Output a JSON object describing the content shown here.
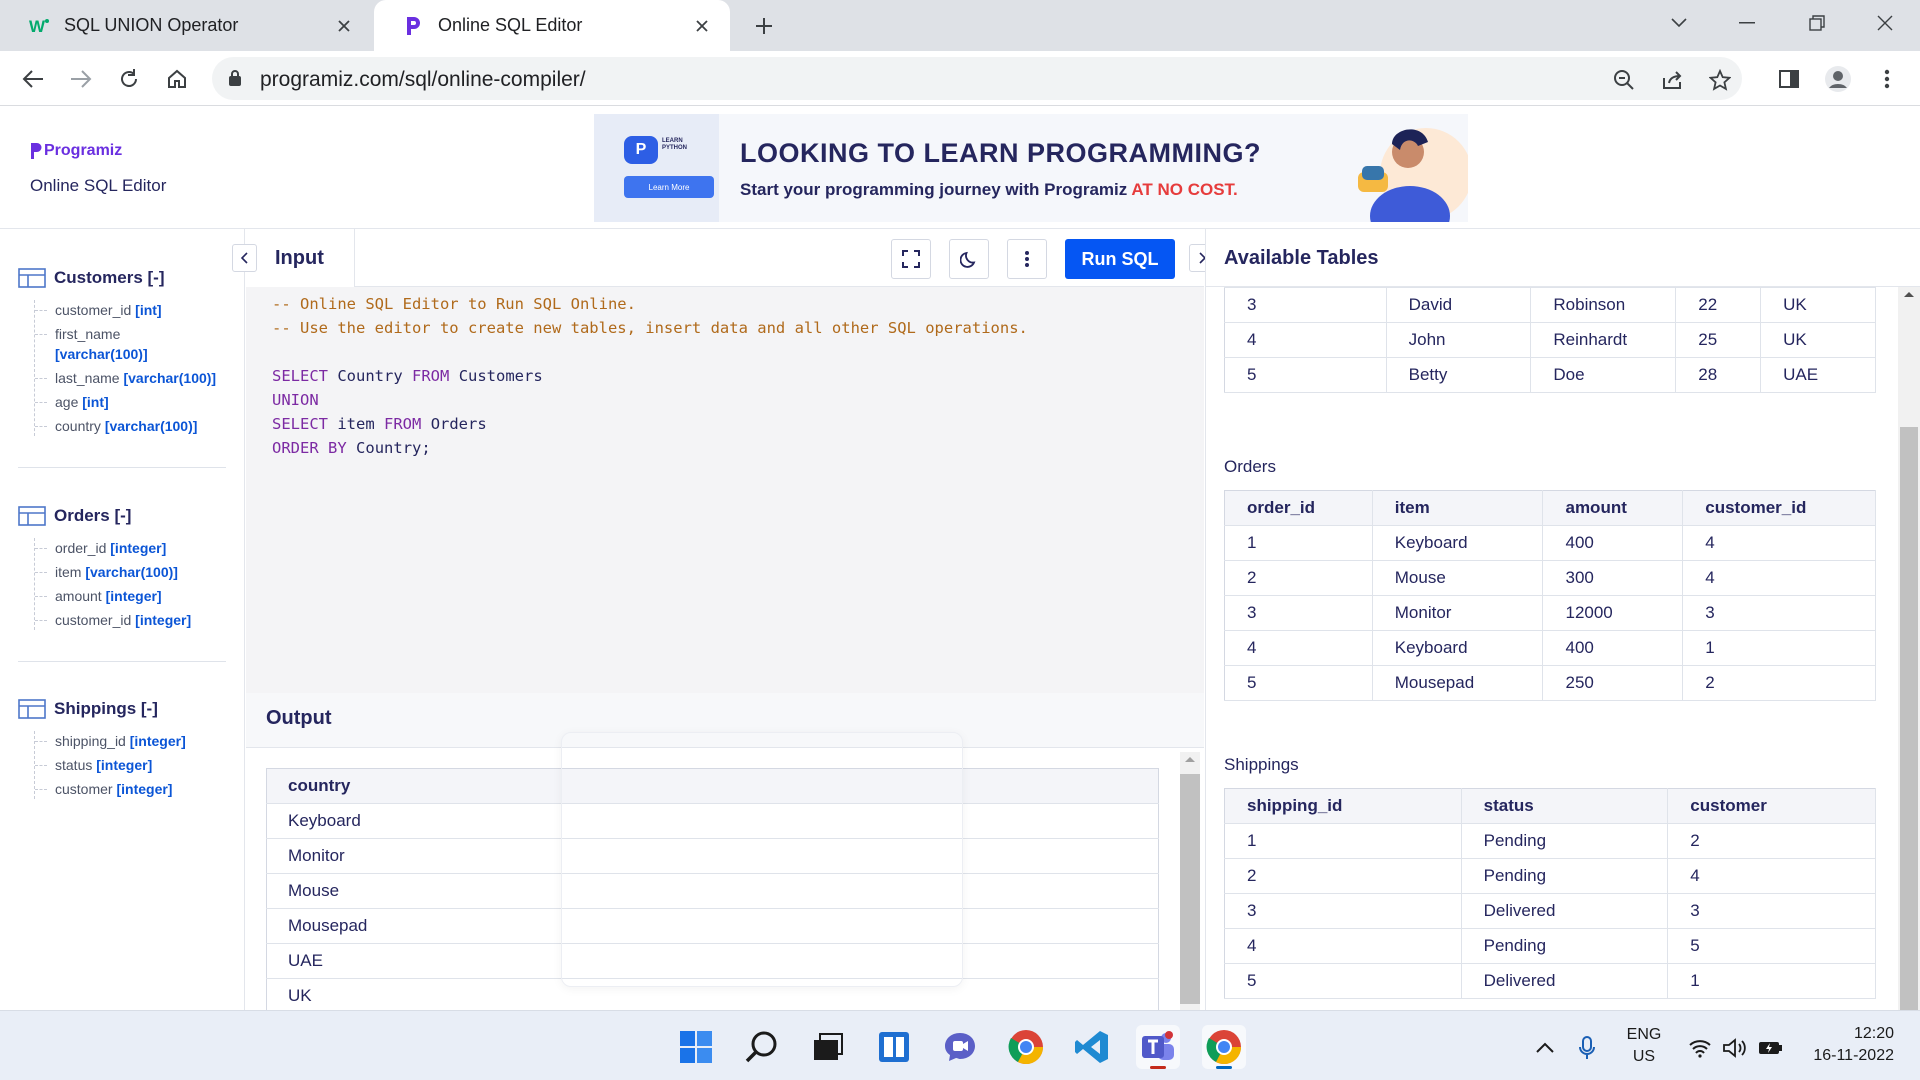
{
  "browser": {
    "tabs": [
      {
        "title": "SQL UNION Operator",
        "active": false
      },
      {
        "title": "Online SQL Editor",
        "active": true
      }
    ],
    "url": "programiz.com/sql/online-compiler/"
  },
  "header": {
    "brand": "Programiz",
    "subtitle": "Online SQL Editor",
    "ad": {
      "badge_text": "LEARN PYTHON",
      "button": "Learn More",
      "headline": "LOOKING TO LEARN PROGRAMMING?",
      "subline": "Start your programming journey with Programiz",
      "subline_accent": "AT NO COST."
    }
  },
  "schema": [
    {
      "name": "Customers [-]",
      "fields": [
        {
          "name": "customer_id",
          "type": "[int]"
        },
        {
          "name": "first_name",
          "type": "[varchar(100)]"
        },
        {
          "name": "last_name",
          "type": "[varchar(100)]"
        },
        {
          "name": "age",
          "type": "[int]"
        },
        {
          "name": "country",
          "type": "[varchar(100)]"
        }
      ]
    },
    {
      "name": "Orders [-]",
      "fields": [
        {
          "name": "order_id",
          "type": "[integer]"
        },
        {
          "name": "item",
          "type": "[varchar(100)]"
        },
        {
          "name": "amount",
          "type": "[integer]"
        },
        {
          "name": "customer_id",
          "type": "[integer]"
        }
      ]
    },
    {
      "name": "Shippings [-]",
      "fields": [
        {
          "name": "shipping_id",
          "type": "[integer]"
        },
        {
          "name": "status",
          "type": "[integer]"
        },
        {
          "name": "customer",
          "type": "[integer]"
        }
      ]
    }
  ],
  "editor": {
    "tab_label": "Input",
    "run_label": "Run SQL",
    "code": [
      {
        "text": "-- Online SQL Editor to Run SQL Online.",
        "kind": "comment"
      },
      {
        "text": "-- Use the editor to create new tables, insert data and all other SQL operations.",
        "kind": "comment"
      },
      {
        "text": "",
        "kind": "plain"
      },
      {
        "text": "SELECT Country FROM Customers",
        "kind": "sql"
      },
      {
        "text": "UNION",
        "kind": "sql"
      },
      {
        "text": "SELECT item FROM Orders",
        "kind": "sql"
      },
      {
        "text": "ORDER BY Country;",
        "kind": "sql"
      }
    ]
  },
  "output": {
    "title": "Output",
    "columns": [
      "country"
    ],
    "rows": [
      [
        "Keyboard"
      ],
      [
        "Monitor"
      ],
      [
        "Mouse"
      ],
      [
        "Mousepad"
      ],
      [
        "UAE"
      ],
      [
        "UK"
      ]
    ]
  },
  "available_tables": {
    "title": "Available Tables",
    "customers_partial": {
      "rows": [
        [
          "3",
          "David",
          "Robinson",
          "22",
          "UK"
        ],
        [
          "4",
          "John",
          "Reinhardt",
          "25",
          "UK"
        ],
        [
          "5",
          "Betty",
          "Doe",
          "28",
          "UAE"
        ]
      ]
    },
    "orders": {
      "caption": "Orders",
      "columns": [
        "order_id",
        "item",
        "amount",
        "customer_id"
      ],
      "rows": [
        [
          "1",
          "Keyboard",
          "400",
          "4"
        ],
        [
          "2",
          "Mouse",
          "300",
          "4"
        ],
        [
          "3",
          "Monitor",
          "12000",
          "3"
        ],
        [
          "4",
          "Keyboard",
          "400",
          "1"
        ],
        [
          "5",
          "Mousepad",
          "250",
          "2"
        ]
      ]
    },
    "shippings": {
      "caption": "Shippings",
      "columns": [
        "shipping_id",
        "status",
        "customer"
      ],
      "rows": [
        [
          "1",
          "Pending",
          "2"
        ],
        [
          "2",
          "Pending",
          "4"
        ],
        [
          "3",
          "Delivered",
          "3"
        ],
        [
          "4",
          "Pending",
          "5"
        ],
        [
          "5",
          "Delivered",
          "1"
        ]
      ]
    }
  },
  "taskbar": {
    "apps": [
      "windows-start",
      "search",
      "task-view",
      "widgets",
      "teams-chat",
      "chrome",
      "vscode",
      "teams",
      "chrome-active"
    ],
    "language_line1": "ENG",
    "language_line2": "US",
    "time": "12:20",
    "date": "16-11-2022"
  },
  "colors": {
    "accent": "#0556f3",
    "brand": "#6a2fe0",
    "text": "#25265e",
    "comment": "#b06a1b",
    "keyword": "#7c2aa3"
  }
}
